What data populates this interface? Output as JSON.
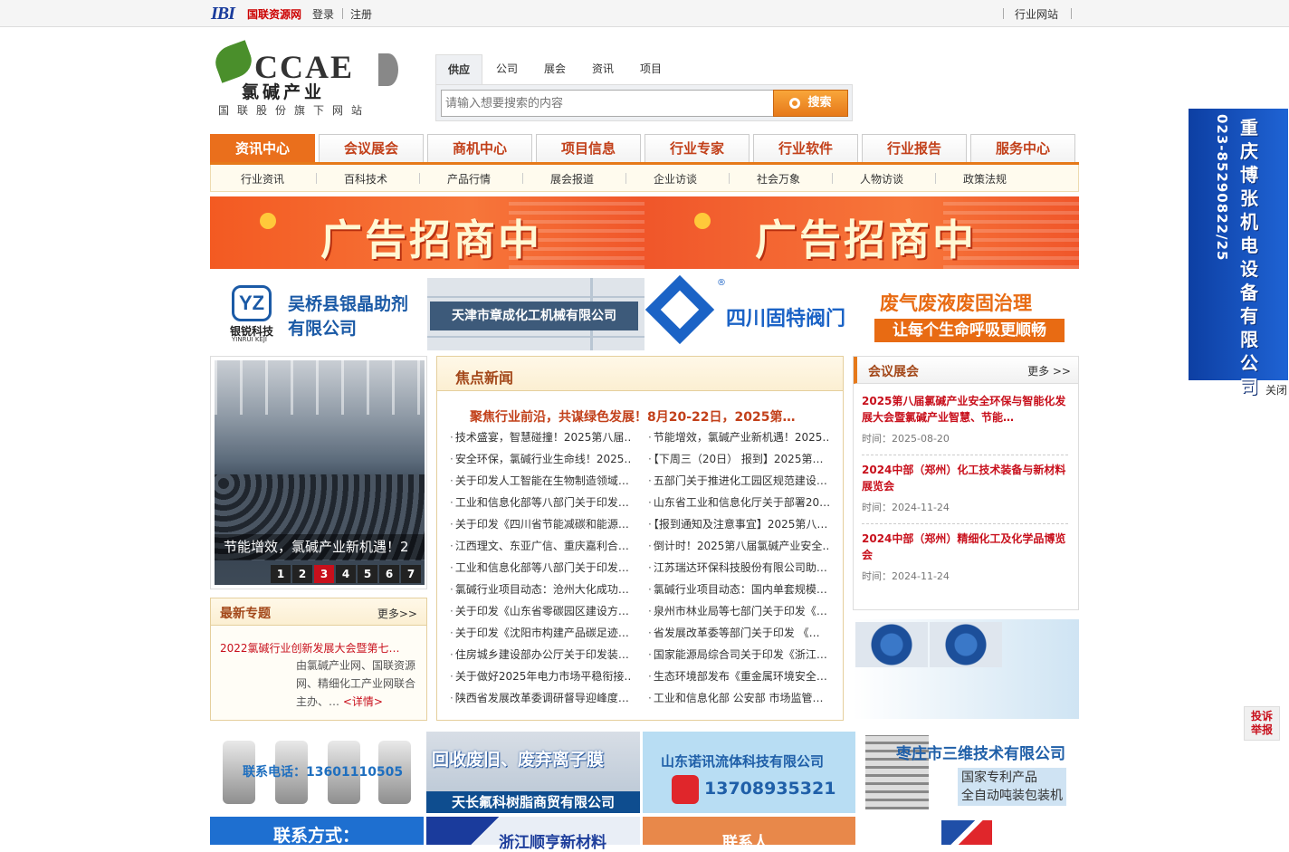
{
  "topbar": {
    "logo_mark": "IBI",
    "brand": "国联资源网",
    "login": "登录",
    "register": "注册",
    "industry_sites": "行业网站"
  },
  "logo": {
    "en": "CCAE",
    "cn": "氯碱产业",
    "sub": "国联股份旗下网站"
  },
  "search": {
    "tabs": [
      {
        "label": "供应"
      },
      {
        "label": "公司"
      },
      {
        "label": "展会"
      },
      {
        "label": "资讯"
      },
      {
        "label": "项目"
      }
    ],
    "placeholder": "请输入想要搜索的内容",
    "button": "搜索"
  },
  "mainnav": [
    {
      "label": "资讯中心"
    },
    {
      "label": "会议展会"
    },
    {
      "label": "商机中心"
    },
    {
      "label": "项目信息"
    },
    {
      "label": "行业专家"
    },
    {
      "label": "行业软件"
    },
    {
      "label": "行业报告"
    },
    {
      "label": "服务中心"
    }
  ],
  "subnav": [
    {
      "label": "行业资讯"
    },
    {
      "label": "百科技术"
    },
    {
      "label": "产品行情"
    },
    {
      "label": "展会报道"
    },
    {
      "label": "企业访谈"
    },
    {
      "label": "社会万象"
    },
    {
      "label": "人物访谈"
    },
    {
      "label": "政策法规"
    }
  ],
  "banner": {
    "text1": "广告招商中",
    "text2": "广告招商中"
  },
  "ads_row1": {
    "ad1_logo": "YZ",
    "ad1_logo_text": "银锐科技",
    "ad1_logo_sub": "YINRUI KEJI",
    "ad1_line1": "吴桥县银晶助剂",
    "ad1_line2": "有限公司",
    "ad2_text": "天津市章成化工机械有限公司",
    "ad3_text": "四川固特阀门",
    "ad3_mark": "®",
    "ad4_line1": "废气废液废固治理",
    "ad4_line2": "让每个生命呼吸更顺畅"
  },
  "slider": {
    "caption": "节能增效，氯碱产业新机遇！2",
    "pages": [
      "1",
      "2",
      "3",
      "4",
      "5",
      "6",
      "7"
    ],
    "active": "3"
  },
  "topics": {
    "title": "最新专题",
    "more": "更多>>",
    "link": "2022氯碱行业创新发展大会暨第七…",
    "desc": "由氯碱产业网、国联资源网、精细化工产业网联合主办、…",
    "detail": "<详情>"
  },
  "news": {
    "title": "焦点新闻",
    "headline": "聚焦行业前沿，共谋绿色发展！8月20-22日，2025第…",
    "left": [
      "技术盛宴，智慧碰撞！2025第八届…",
      "安全环保，氯碱行业生命线！2025…",
      "关于印发人工智能在生物制造领域…",
      "工业和信息化部等八部门关于印发…",
      "关于印发《四川省节能减碳和能源…",
      "江西理文、东亚广信、重庆嘉利合…",
      "工业和信息化部等八部门关于印发…",
      "氯碱行业项目动态：沧州大化成功…",
      "关于印发《山东省零碳园区建设方…",
      "关于印发《沈阳市构建产品碳足迹…",
      "住房城乡建设部办公厅关于印发装…",
      "关于做好2025年电力市场平稳衔接…",
      "陕西省发展改革委调研督导迎峰度…"
    ],
    "right": [
      "节能增效，氯碱产业新机遇！2025…",
      "【下周三（20日） 报到】2025第…",
      "五部门关于推进化工园区规范建设…",
      "山东省工业和信息化厅关于部署20…",
      "【报到通知及注意事宜】2025第八…",
      "倒计时！2025第八届氯碱产业安全…",
      "江苏瑞达环保科技股份有限公司助…",
      "氯碱行业项目动态：国内单套规模…",
      "泉州市林业局等七部门关于印发《…",
      "省发展改革委等部门关于印发 《…",
      "国家能源局综合司关于印发《浙江…",
      "生态环境部发布《重金属环境安全…",
      "工业和信息化部 公安部 市场监管…"
    ]
  },
  "expo": {
    "title": "会议展会",
    "more": "更多 >>",
    "items": [
      {
        "title": "2025第八届氯碱产业安全环保与智能化发展大会暨氯碱产业智慧、节能…",
        "date": "时间：2025-08-20"
      },
      {
        "title": "2024中部（郑州）化工技术装备与新材料展览会",
        "date": "时间：2024-11-24"
      },
      {
        "title": "2024中部（郑州）精细化工及化学品博览会",
        "date": "时间：2024-11-24"
      }
    ]
  },
  "ads_row2": {
    "b1_text": "联系电话：13601110505",
    "b2_line1": "回收废旧、废弃离子膜",
    "b2_line2": "天长氟科树脂商贸有限公司",
    "b3_line1": "山东诺讯流体科技有限公司",
    "b3_line2": "13708935321",
    "b4_line1": "枣庄市三维技术有限公司",
    "b4_line2": "国家专利产品",
    "b4_line3": "全自动吨装包装机"
  },
  "ads_row3": {
    "c1_text": "联系方式：",
    "c2_text": "浙江顺亨新材料",
    "c3_text": "联系人"
  },
  "float_ad": {
    "name": "重庆博张机电设备有限公司",
    "phone": "023-85290822/25",
    "close": "关闭"
  },
  "report": {
    "line1": "投诉",
    "line2": "举报"
  }
}
